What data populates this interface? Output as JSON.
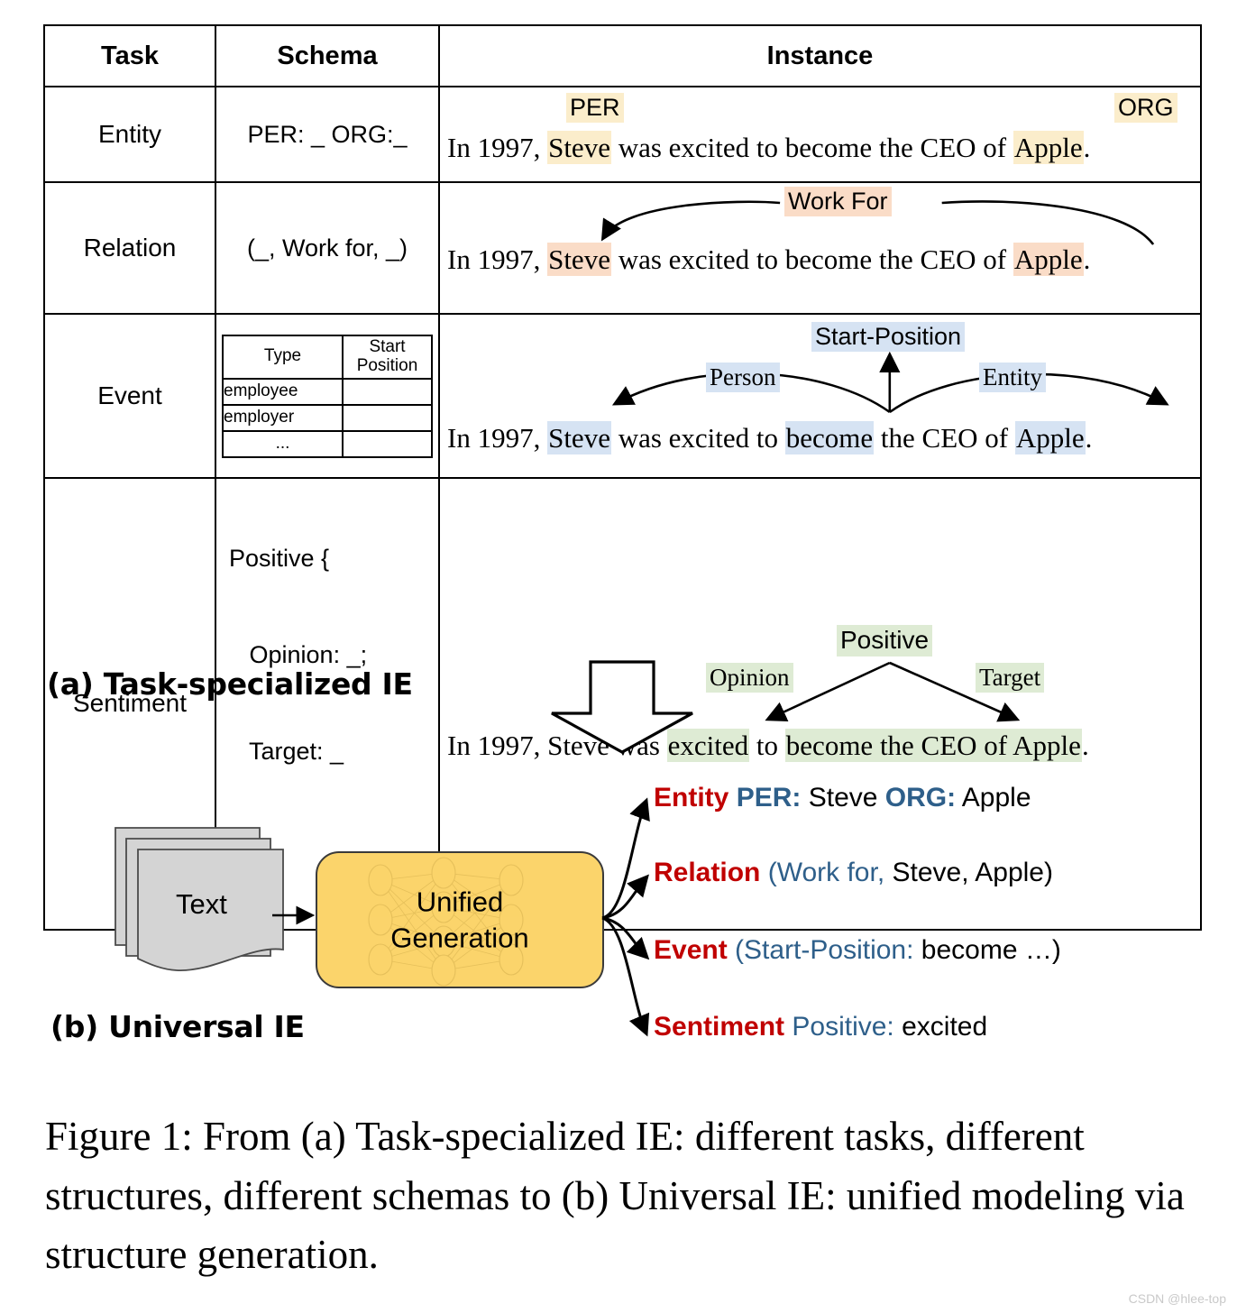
{
  "table": {
    "headers": [
      "Task",
      "Schema",
      "Instance"
    ],
    "rows": [
      {
        "task": "Entity",
        "schema": "PER: _  ORG:_",
        "sentence_parts": [
          "In 1997, ",
          "Steve",
          " was excited to become the CEO of ",
          "Apple",
          "."
        ],
        "tags": [
          "PER",
          "ORG"
        ],
        "highlight": "#FBEDCB"
      },
      {
        "task": "Relation",
        "schema": "(_, Work for, _)",
        "sentence_parts": [
          "In 1997, ",
          "Steve",
          " was excited to become the CEO of ",
          "Apple",
          "."
        ],
        "tags": [
          "Work For"
        ],
        "highlight": "#FADCC7"
      },
      {
        "task": "Event",
        "schema_table": {
          "headers": [
            "Type",
            "Start Position"
          ],
          "header_line1": "Start",
          "header_line2": "Position",
          "rows": [
            "employee",
            "employer",
            "..."
          ]
        },
        "sentence_parts": [
          "In 1997, ",
          "Steve",
          " was excited to ",
          "become",
          " the CEO of ",
          "Apple",
          "."
        ],
        "tags": [
          "Start-Position",
          "Person",
          "Entity"
        ],
        "highlight": "#D6E3F3"
      },
      {
        "task": "Sentiment",
        "schema_lines": [
          "Positive {",
          "   Opinion: _;",
          "   Target: _",
          "}"
        ],
        "sentence_parts": [
          "In 1997, Steve was ",
          "excited",
          " to ",
          "become the CEO of Apple",
          "."
        ],
        "tags": [
          "Positive",
          "Opinion",
          "Target"
        ],
        "highlight": "#DEEBD4"
      }
    ]
  },
  "sections": {
    "a_label": "(a) Task-specialized IE",
    "b_label": "(b) Universal IE"
  },
  "diagram": {
    "text_doc_label": "Text",
    "unified_line1": "Unified",
    "unified_line2": "Generation",
    "unified_box_color": "#FBD46B",
    "outputs": [
      {
        "task": "Entity",
        "type": "PER:",
        "value": "Steve",
        "type2": "ORG:",
        "value2": "Apple",
        "open": "",
        "close": ""
      },
      {
        "task": "Relation",
        "type": "(Work for,",
        "value": "Steve, Apple)",
        "type2": "",
        "value2": "",
        "open": "",
        "close": ""
      },
      {
        "task": "Event",
        "type": "(Start-Position:",
        "value": "become …)",
        "type2": "",
        "value2": "",
        "open": "",
        "close": ""
      },
      {
        "task": "Sentiment",
        "type": "Positive:",
        "value": "excited",
        "type2": "",
        "value2": "",
        "open": "",
        "close": ""
      }
    ],
    "label_color": "#C00000",
    "type_color": "#2E5F8A",
    "value_color": "#000000"
  },
  "caption": "Figure 1: From (a) Task-specialized IE: different tasks, different structures, different schemas to (b) Universal IE: unified modeling via structure generation.",
  "watermark": "CSDN @hlee-top"
}
